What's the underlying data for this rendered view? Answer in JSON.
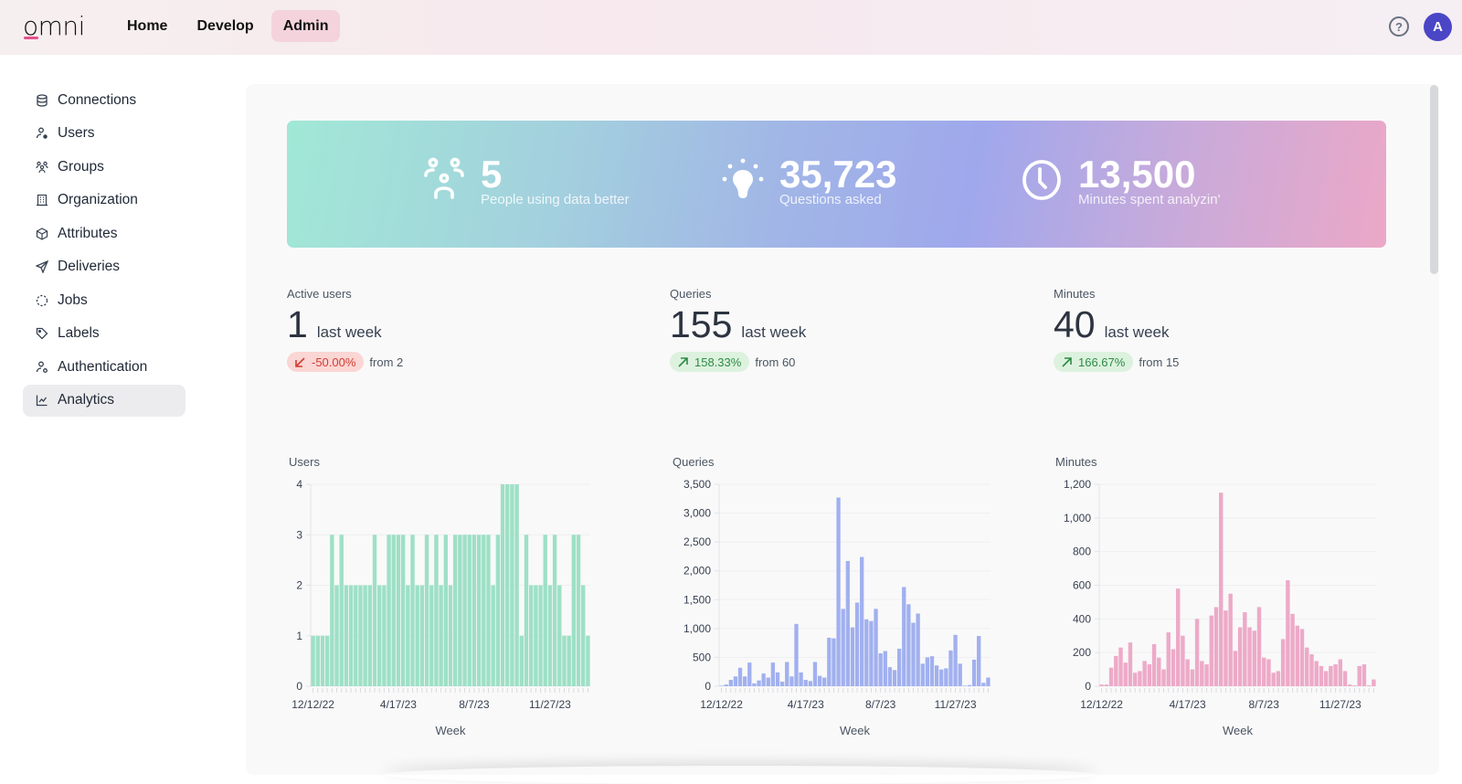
{
  "app": {
    "logo": "omni"
  },
  "nav": {
    "items": [
      {
        "label": "Home"
      },
      {
        "label": "Develop"
      },
      {
        "label": "Admin",
        "active": true
      }
    ]
  },
  "header": {
    "help_icon": "question-circle-icon",
    "avatar_initial": "A",
    "avatar_color": "#4b46c6"
  },
  "sidebar": {
    "items": [
      {
        "label": "Connections",
        "icon": "database-icon"
      },
      {
        "label": "Users",
        "icon": "user-icon"
      },
      {
        "label": "Groups",
        "icon": "group-icon"
      },
      {
        "label": "Organization",
        "icon": "building-icon"
      },
      {
        "label": "Attributes",
        "icon": "cube-icon"
      },
      {
        "label": "Deliveries",
        "icon": "send-icon"
      },
      {
        "label": "Jobs",
        "icon": "dashed-circle-icon"
      },
      {
        "label": "Labels",
        "icon": "tag-icon"
      },
      {
        "label": "Authentication",
        "icon": "user-key-icon"
      },
      {
        "label": "Analytics",
        "icon": "chart-icon",
        "active": true
      }
    ]
  },
  "banner": {
    "stats": [
      {
        "value": "5",
        "label": "People using data better",
        "icon": "people-icon"
      },
      {
        "value": "35,723",
        "label": "Questions asked",
        "icon": "lightbulb-icon"
      },
      {
        "value": "13,500",
        "label": "Minutes spent analyzin'",
        "icon": "clock-icon"
      }
    ]
  },
  "kpis": [
    {
      "title": "Active users",
      "value": "1",
      "unit": "last week",
      "delta": "-50.00%",
      "direction": "down",
      "from": "from 2"
    },
    {
      "title": "Queries",
      "value": "155",
      "unit": "last week",
      "delta": "158.33%",
      "direction": "up",
      "from": "from 60"
    },
    {
      "title": "Minutes",
      "value": "40",
      "unit": "last week",
      "delta": "166.67%",
      "direction": "up",
      "from": "from 15"
    }
  ],
  "chart_data": [
    {
      "type": "bar",
      "title": "Users",
      "xlabel": "Week",
      "ylabel": "",
      "color": "#9ee0c6",
      "ylim": [
        0,
        4
      ],
      "yticks": [
        0,
        1,
        2,
        3,
        4
      ],
      "ytick_labels": [
        "0",
        "1",
        "2",
        "3",
        "4"
      ],
      "xtick_labels": [
        {
          "index": 0,
          "label": "12/12/22"
        },
        {
          "index": 18,
          "label": "4/17/23"
        },
        {
          "index": 34,
          "label": "8/7/23"
        },
        {
          "index": 50,
          "label": "11/27/23"
        }
      ],
      "values": [
        1,
        1,
        1,
        1,
        3,
        2,
        3,
        2,
        2,
        2,
        2,
        2,
        2,
        3,
        2,
        2,
        3,
        3,
        3,
        3,
        2,
        3,
        2,
        2,
        3,
        2,
        3,
        2,
        3,
        2,
        3,
        3,
        3,
        3,
        3,
        3,
        3,
        3,
        2,
        3,
        4,
        4,
        4,
        4,
        1,
        3,
        2,
        2,
        2,
        3,
        2,
        3,
        2,
        1,
        1,
        3,
        3,
        2,
        1
      ]
    },
    {
      "type": "bar",
      "title": "Queries",
      "xlabel": "Week",
      "ylabel": "",
      "color": "#a1b0ef",
      "ylim": [
        0,
        3500
      ],
      "yticks": [
        0,
        500,
        1000,
        1500,
        2000,
        2500,
        3000,
        3500
      ],
      "ytick_labels": [
        "0",
        "500",
        "1,000",
        "1,500",
        "2,000",
        "2,500",
        "3,000",
        "3,500"
      ],
      "xtick_labels": [
        {
          "index": 0,
          "label": "12/12/22"
        },
        {
          "index": 18,
          "label": "4/17/23"
        },
        {
          "index": 34,
          "label": "8/7/23"
        },
        {
          "index": 50,
          "label": "11/27/23"
        }
      ],
      "values": [
        10,
        30,
        110,
        170,
        320,
        170,
        410,
        50,
        100,
        220,
        150,
        410,
        240,
        80,
        420,
        170,
        1080,
        240,
        110,
        90,
        420,
        180,
        150,
        840,
        830,
        3270,
        1340,
        2170,
        1020,
        1450,
        2240,
        1160,
        1130,
        1340,
        570,
        610,
        330,
        280,
        650,
        1720,
        1420,
        1100,
        1260,
        390,
        500,
        520,
        360,
        290,
        310,
        620,
        890,
        390,
        10,
        20,
        460,
        870,
        60,
        150
      ]
    },
    {
      "type": "bar",
      "title": "Minutes",
      "xlabel": "Week",
      "ylabel": "",
      "color": "#edaac8",
      "ylim": [
        0,
        1200
      ],
      "yticks": [
        0,
        200,
        400,
        600,
        800,
        1000,
        1200
      ],
      "ytick_labels": [
        "0",
        "200",
        "400",
        "600",
        "800",
        "1,000",
        "1,200"
      ],
      "xtick_labels": [
        {
          "index": 0,
          "label": "12/12/22"
        },
        {
          "index": 18,
          "label": "4/17/23"
        },
        {
          "index": 34,
          "label": "8/7/23"
        },
        {
          "index": 50,
          "label": "11/27/23"
        }
      ],
      "values": [
        10,
        10,
        110,
        180,
        230,
        140,
        260,
        80,
        90,
        150,
        130,
        250,
        170,
        100,
        320,
        220,
        580,
        300,
        160,
        100,
        400,
        150,
        130,
        420,
        470,
        1150,
        450,
        550,
        210,
        350,
        440,
        350,
        330,
        470,
        170,
        160,
        80,
        90,
        280,
        630,
        430,
        360,
        340,
        230,
        190,
        150,
        120,
        90,
        120,
        130,
        160,
        90,
        10,
        5,
        120,
        130,
        5,
        40
      ]
    }
  ]
}
